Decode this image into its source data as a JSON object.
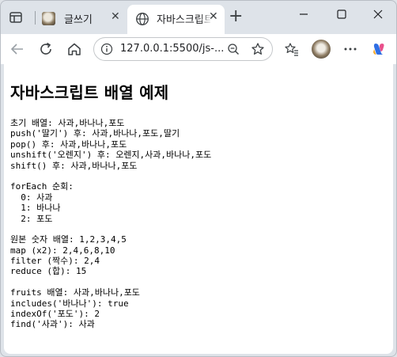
{
  "browser": {
    "tabs": [
      {
        "title": "글쓰기",
        "active": false
      },
      {
        "title": "자바스크립트",
        "active": true
      }
    ],
    "address_bar": {
      "url": "127.0.0.1:5500/js-..."
    },
    "colors": {
      "frame": "#dee3e9",
      "active_tab": "#ffffff"
    }
  },
  "page": {
    "heading": "자바스크립트 배열 예제",
    "output_lines": [
      "초기 배열: 사과,바나나,포도",
      "push('딸기') 후: 사과,바나나,포도,딸기",
      "pop() 후: 사과,바나나,포도",
      "unshift('오렌지') 후: 오렌지,사과,바나나,포도",
      "shift() 후: 사과,바나나,포도",
      "",
      "forEach 순회:",
      "  0: 사과",
      "  1: 바나나",
      "  2: 포도",
      "",
      "원본 숫자 배열: 1,2,3,4,5",
      "map (x2): 2,4,6,8,10",
      "filter (짝수): 2,4",
      "reduce (합): 15",
      "",
      "fruits 배열: 사과,바나나,포도",
      "includes('바나나'): true",
      "indexOf('포도'): 2",
      "find('사과'): 사과"
    ]
  }
}
